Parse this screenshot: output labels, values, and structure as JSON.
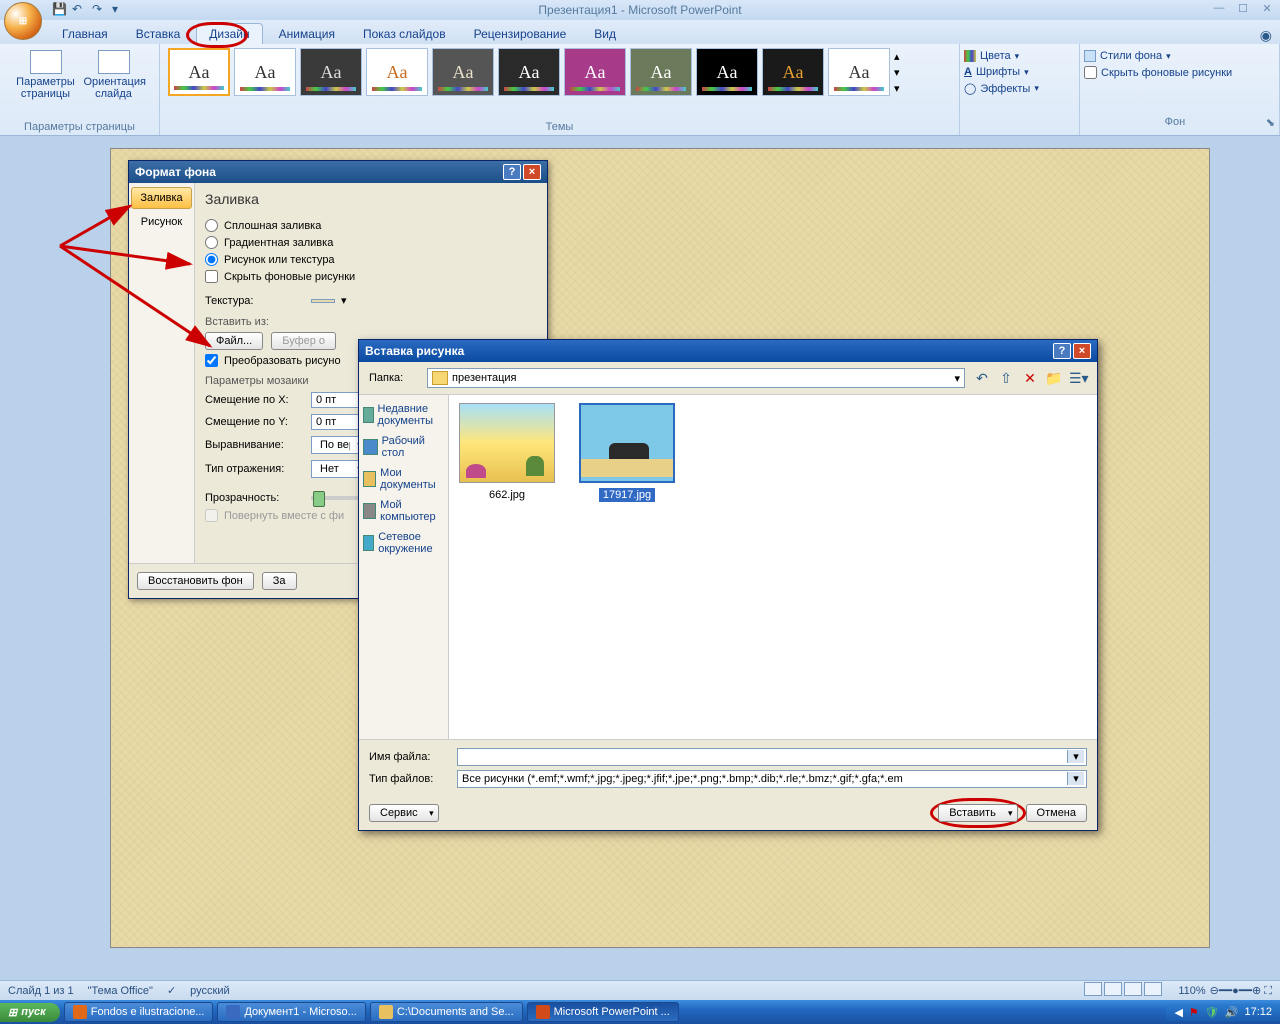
{
  "app": {
    "title": "Презентация1 - Microsoft PowerPoint"
  },
  "ribbon": {
    "tabs": [
      "Главная",
      "Вставка",
      "Дизайн",
      "Анимация",
      "Показ слайдов",
      "Рецензирование",
      "Вид"
    ],
    "active_tab": "Дизайн",
    "page_group": {
      "label": "Параметры страницы",
      "btn_page": "Параметры страницы",
      "btn_orient": "Ориентация слайда"
    },
    "themes_group": {
      "label": "Темы"
    },
    "theme_thumbs": [
      {
        "aa": "Aa",
        "bg": "#fff",
        "fg": "#333"
      },
      {
        "aa": "Aa",
        "bg": "#fff",
        "fg": "#333"
      },
      {
        "aa": "Aa",
        "bg": "#3a3a3a",
        "fg": "#ddd"
      },
      {
        "aa": "Aa",
        "bg": "#fff",
        "fg": "#c96a1a"
      },
      {
        "aa": "Aa",
        "bg": "#555",
        "fg": "#e8e0c8"
      },
      {
        "aa": "Aa",
        "bg": "#2a2a2a",
        "fg": "#fff"
      },
      {
        "aa": "Aa",
        "bg": "#a83a8a",
        "fg": "#fff"
      },
      {
        "aa": "Aa",
        "bg": "#6a7a5a",
        "fg": "#fff"
      },
      {
        "aa": "Aa",
        "bg": "#000",
        "fg": "#fff"
      },
      {
        "aa": "Aa",
        "bg": "#1a1a1a",
        "fg": "#e8a030"
      },
      {
        "aa": "Aa",
        "bg": "#fff",
        "fg": "#333"
      }
    ],
    "theme_tools": {
      "colors": "Цвета",
      "fonts": "Шрифты",
      "effects": "Эффекты"
    },
    "bg_group": {
      "label": "Фон",
      "styles": "Стили фона",
      "hide": "Скрыть фоновые рисунки"
    }
  },
  "format_dialog": {
    "title": "Формат фона",
    "nav_fill": "Заливка",
    "nav_pic": "Рисунок",
    "heading": "Заливка",
    "radio_solid": "Сплошная заливка",
    "radio_gradient": "Градиентная заливка",
    "radio_texture": "Рисунок или текстура",
    "chk_hide": "Скрыть фоновые рисунки",
    "texture_label": "Текстура:",
    "insert_from": "Вставить из:",
    "btn_file": "Файл...",
    "btn_clipboard": "Буфер о",
    "chk_tile": "Преобразовать рисуно",
    "mosaic_params": "Параметры мозаики",
    "offset_x": "Смещение по X:",
    "offset_y": "Смещение по Y:",
    "offset_x_val": "0 пт",
    "offset_y_val": "0 пт",
    "align": "Выравнивание:",
    "align_val": "По вер",
    "mirror": "Тип отражения:",
    "mirror_val": "Нет",
    "transparency": "Прозрачность:",
    "chk_rotate": "Повернуть вместе с фи",
    "btn_reset": "Восстановить фон",
    "btn_close": "За"
  },
  "insert_dialog": {
    "title": "Вставка рисунка",
    "folder_label": "Папка:",
    "folder_value": "презентация",
    "places": [
      "Недавние документы",
      "Рабочий стол",
      "Мои документы",
      "Мой компьютер",
      "Сетевое окружение"
    ],
    "files": [
      {
        "name": "662.jpg",
        "selected": false
      },
      {
        "name": "17917.jpg",
        "selected": true
      }
    ],
    "filename_label": "Имя файла:",
    "filename_value": "",
    "filetype_label": "Тип файлов:",
    "filetype_value": "Все рисунки (*.emf;*.wmf;*.jpg;*.jpeg;*.jfif;*.jpe;*.png;*.bmp;*.dib;*.rle;*.bmz;*.gif;*.gfa;*.em",
    "btn_tools": "Сервис",
    "btn_insert": "Вставить",
    "btn_cancel": "Отмена"
  },
  "status": {
    "slide": "Слайд 1 из 1",
    "theme": "\"Тема Office\"",
    "lang": "русский",
    "zoom": "110%"
  },
  "taskbar": {
    "start": "пуск",
    "items": [
      "Fondos e ilustracione...",
      "Документ1 - Microso...",
      "C:\\Documents and Se...",
      "Microsoft PowerPoint ..."
    ],
    "time": "17:12"
  }
}
